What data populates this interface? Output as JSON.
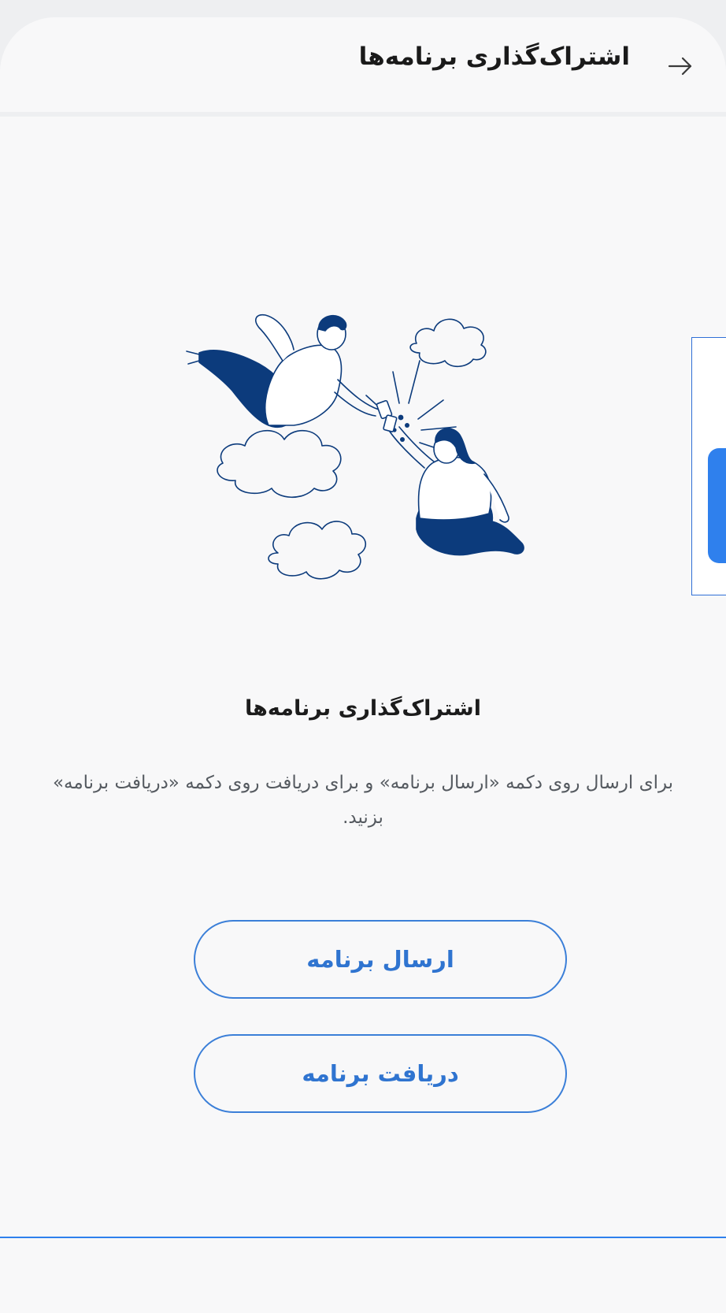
{
  "header": {
    "title": "اشتراک‌گذاری برنامه‌ها",
    "back_icon": "arrow-right-icon"
  },
  "illustration": {
    "name": "people-sharing-apps-illustration"
  },
  "content": {
    "title": "اشتراک‌گذاری برنامه‌ها",
    "description": "برای ارسال روی دکمه «ارسال برنامه» و برای دریافت روی دکمه «دریافت برنامه» بزنید."
  },
  "actions": {
    "send_label": "ارسال برنامه",
    "receive_label": "دریافت برنامه"
  },
  "colors": {
    "accent": "#2f80ed",
    "illustration_fill": "#0c3b7c",
    "background": "#f8f8f9"
  }
}
